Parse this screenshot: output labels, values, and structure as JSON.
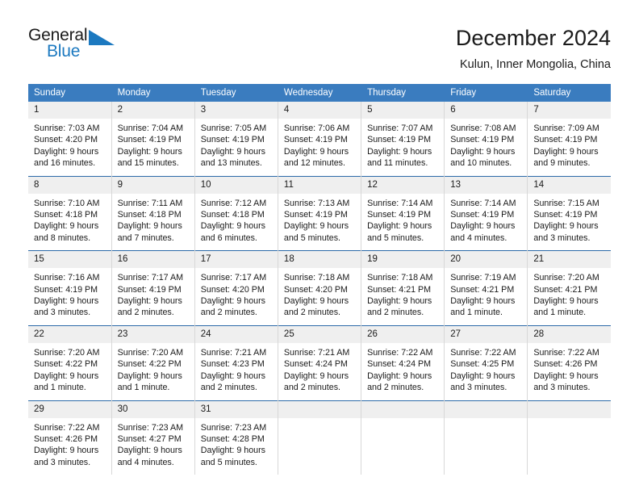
{
  "brand": {
    "name_line1": "General",
    "name_line2": "Blue",
    "accent_color": "#1c79c0",
    "logo_icon": "triangle-flag-icon"
  },
  "header": {
    "title": "December 2024",
    "subtitle": "Kulun, Inner Mongolia, China"
  },
  "theme": {
    "header_bar_color": "#3a7cbf",
    "row_rule_color": "#2c6aa8",
    "daynum_band_color": "#efefef",
    "cell_divider_color": "#d8d8d8"
  },
  "weekday_headers": [
    "Sunday",
    "Monday",
    "Tuesday",
    "Wednesday",
    "Thursday",
    "Friday",
    "Saturday"
  ],
  "weeks": [
    {
      "days": [
        {
          "day": "1",
          "sunrise": "Sunrise: 7:03 AM",
          "sunset": "Sunset: 4:20 PM",
          "daylight_line1": "Daylight: 9 hours",
          "daylight_line2": "and 16 minutes."
        },
        {
          "day": "2",
          "sunrise": "Sunrise: 7:04 AM",
          "sunset": "Sunset: 4:19 PM",
          "daylight_line1": "Daylight: 9 hours",
          "daylight_line2": "and 15 minutes."
        },
        {
          "day": "3",
          "sunrise": "Sunrise: 7:05 AM",
          "sunset": "Sunset: 4:19 PM",
          "daylight_line1": "Daylight: 9 hours",
          "daylight_line2": "and 13 minutes."
        },
        {
          "day": "4",
          "sunrise": "Sunrise: 7:06 AM",
          "sunset": "Sunset: 4:19 PM",
          "daylight_line1": "Daylight: 9 hours",
          "daylight_line2": "and 12 minutes."
        },
        {
          "day": "5",
          "sunrise": "Sunrise: 7:07 AM",
          "sunset": "Sunset: 4:19 PM",
          "daylight_line1": "Daylight: 9 hours",
          "daylight_line2": "and 11 minutes."
        },
        {
          "day": "6",
          "sunrise": "Sunrise: 7:08 AM",
          "sunset": "Sunset: 4:19 PM",
          "daylight_line1": "Daylight: 9 hours",
          "daylight_line2": "and 10 minutes."
        },
        {
          "day": "7",
          "sunrise": "Sunrise: 7:09 AM",
          "sunset": "Sunset: 4:19 PM",
          "daylight_line1": "Daylight: 9 hours",
          "daylight_line2": "and 9 minutes."
        }
      ]
    },
    {
      "days": [
        {
          "day": "8",
          "sunrise": "Sunrise: 7:10 AM",
          "sunset": "Sunset: 4:18 PM",
          "daylight_line1": "Daylight: 9 hours",
          "daylight_line2": "and 8 minutes."
        },
        {
          "day": "9",
          "sunrise": "Sunrise: 7:11 AM",
          "sunset": "Sunset: 4:18 PM",
          "daylight_line1": "Daylight: 9 hours",
          "daylight_line2": "and 7 minutes."
        },
        {
          "day": "10",
          "sunrise": "Sunrise: 7:12 AM",
          "sunset": "Sunset: 4:18 PM",
          "daylight_line1": "Daylight: 9 hours",
          "daylight_line2": "and 6 minutes."
        },
        {
          "day": "11",
          "sunrise": "Sunrise: 7:13 AM",
          "sunset": "Sunset: 4:19 PM",
          "daylight_line1": "Daylight: 9 hours",
          "daylight_line2": "and 5 minutes."
        },
        {
          "day": "12",
          "sunrise": "Sunrise: 7:14 AM",
          "sunset": "Sunset: 4:19 PM",
          "daylight_line1": "Daylight: 9 hours",
          "daylight_line2": "and 5 minutes."
        },
        {
          "day": "13",
          "sunrise": "Sunrise: 7:14 AM",
          "sunset": "Sunset: 4:19 PM",
          "daylight_line1": "Daylight: 9 hours",
          "daylight_line2": "and 4 minutes."
        },
        {
          "day": "14",
          "sunrise": "Sunrise: 7:15 AM",
          "sunset": "Sunset: 4:19 PM",
          "daylight_line1": "Daylight: 9 hours",
          "daylight_line2": "and 3 minutes."
        }
      ]
    },
    {
      "days": [
        {
          "day": "15",
          "sunrise": "Sunrise: 7:16 AM",
          "sunset": "Sunset: 4:19 PM",
          "daylight_line1": "Daylight: 9 hours",
          "daylight_line2": "and 3 minutes."
        },
        {
          "day": "16",
          "sunrise": "Sunrise: 7:17 AM",
          "sunset": "Sunset: 4:19 PM",
          "daylight_line1": "Daylight: 9 hours",
          "daylight_line2": "and 2 minutes."
        },
        {
          "day": "17",
          "sunrise": "Sunrise: 7:17 AM",
          "sunset": "Sunset: 4:20 PM",
          "daylight_line1": "Daylight: 9 hours",
          "daylight_line2": "and 2 minutes."
        },
        {
          "day": "18",
          "sunrise": "Sunrise: 7:18 AM",
          "sunset": "Sunset: 4:20 PM",
          "daylight_line1": "Daylight: 9 hours",
          "daylight_line2": "and 2 minutes."
        },
        {
          "day": "19",
          "sunrise": "Sunrise: 7:18 AM",
          "sunset": "Sunset: 4:21 PM",
          "daylight_line1": "Daylight: 9 hours",
          "daylight_line2": "and 2 minutes."
        },
        {
          "day": "20",
          "sunrise": "Sunrise: 7:19 AM",
          "sunset": "Sunset: 4:21 PM",
          "daylight_line1": "Daylight: 9 hours",
          "daylight_line2": "and 1 minute."
        },
        {
          "day": "21",
          "sunrise": "Sunrise: 7:20 AM",
          "sunset": "Sunset: 4:21 PM",
          "daylight_line1": "Daylight: 9 hours",
          "daylight_line2": "and 1 minute."
        }
      ]
    },
    {
      "days": [
        {
          "day": "22",
          "sunrise": "Sunrise: 7:20 AM",
          "sunset": "Sunset: 4:22 PM",
          "daylight_line1": "Daylight: 9 hours",
          "daylight_line2": "and 1 minute."
        },
        {
          "day": "23",
          "sunrise": "Sunrise: 7:20 AM",
          "sunset": "Sunset: 4:22 PM",
          "daylight_line1": "Daylight: 9 hours",
          "daylight_line2": "and 1 minute."
        },
        {
          "day": "24",
          "sunrise": "Sunrise: 7:21 AM",
          "sunset": "Sunset: 4:23 PM",
          "daylight_line1": "Daylight: 9 hours",
          "daylight_line2": "and 2 minutes."
        },
        {
          "day": "25",
          "sunrise": "Sunrise: 7:21 AM",
          "sunset": "Sunset: 4:24 PM",
          "daylight_line1": "Daylight: 9 hours",
          "daylight_line2": "and 2 minutes."
        },
        {
          "day": "26",
          "sunrise": "Sunrise: 7:22 AM",
          "sunset": "Sunset: 4:24 PM",
          "daylight_line1": "Daylight: 9 hours",
          "daylight_line2": "and 2 minutes."
        },
        {
          "day": "27",
          "sunrise": "Sunrise: 7:22 AM",
          "sunset": "Sunset: 4:25 PM",
          "daylight_line1": "Daylight: 9 hours",
          "daylight_line2": "and 3 minutes."
        },
        {
          "day": "28",
          "sunrise": "Sunrise: 7:22 AM",
          "sunset": "Sunset: 4:26 PM",
          "daylight_line1": "Daylight: 9 hours",
          "daylight_line2": "and 3 minutes."
        }
      ]
    },
    {
      "days": [
        {
          "day": "29",
          "sunrise": "Sunrise: 7:22 AM",
          "sunset": "Sunset: 4:26 PM",
          "daylight_line1": "Daylight: 9 hours",
          "daylight_line2": "and 3 minutes."
        },
        {
          "day": "30",
          "sunrise": "Sunrise: 7:23 AM",
          "sunset": "Sunset: 4:27 PM",
          "daylight_line1": "Daylight: 9 hours",
          "daylight_line2": "and 4 minutes."
        },
        {
          "day": "31",
          "sunrise": "Sunrise: 7:23 AM",
          "sunset": "Sunset: 4:28 PM",
          "daylight_line1": "Daylight: 9 hours",
          "daylight_line2": "and 5 minutes."
        },
        {
          "day": "",
          "sunrise": "",
          "sunset": "",
          "daylight_line1": "",
          "daylight_line2": ""
        },
        {
          "day": "",
          "sunrise": "",
          "sunset": "",
          "daylight_line1": "",
          "daylight_line2": ""
        },
        {
          "day": "",
          "sunrise": "",
          "sunset": "",
          "daylight_line1": "",
          "daylight_line2": ""
        },
        {
          "day": "",
          "sunrise": "",
          "sunset": "",
          "daylight_line1": "",
          "daylight_line2": ""
        }
      ]
    }
  ]
}
